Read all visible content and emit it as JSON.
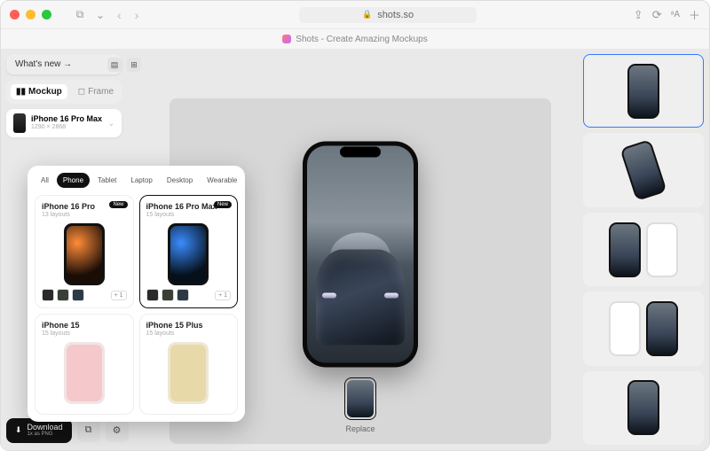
{
  "browser": {
    "url_host": "shots.so",
    "page_title": "Shots - Create Amazing Mockups"
  },
  "header": {
    "whats_new": "What's new →"
  },
  "mode_tabs": {
    "mockup": "Mockup",
    "frame": "Frame"
  },
  "device_selector": {
    "name": "iPhone 16 Pro Max",
    "resolution": "1290 × 2868"
  },
  "category_tabs": [
    "All",
    "Phone",
    "Tablet",
    "Laptop",
    "Desktop",
    "Wearable"
  ],
  "devices": [
    {
      "name": "iPhone 16 Pro",
      "layouts": "13 layouts",
      "badge": "New",
      "more": "+ 1"
    },
    {
      "name": "iPhone 16 Pro Max",
      "layouts": "15 layouts",
      "badge": "New",
      "more": "+ 1"
    },
    {
      "name": "iPhone 15",
      "layouts": "15 layouts"
    },
    {
      "name": "iPhone 15 Plus",
      "layouts": "15 layouts"
    }
  ],
  "download": {
    "label": "Download",
    "sub": "1x as PNG"
  },
  "replace": {
    "label": "Replace"
  }
}
